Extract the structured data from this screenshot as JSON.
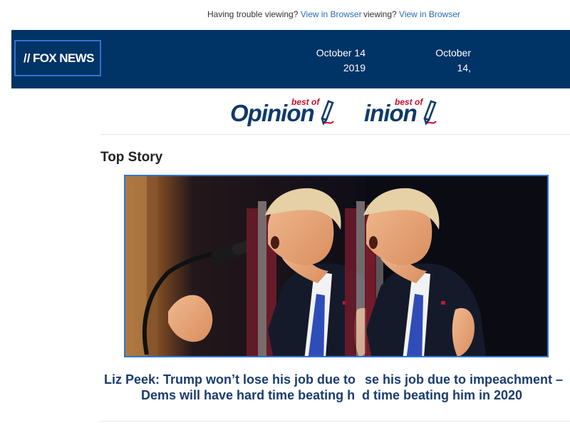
{
  "topbar": {
    "trouble_text": "Having trouble viewing?",
    "trouble_text_tail": "viewing?",
    "view_link": "View in Browser"
  },
  "header": {
    "logo_text": "FOX NEWS",
    "date_line1": "October 14,",
    "date_line2": "2019",
    "date_cut_line1": "October 14",
    "date_cut_line2": "2019"
  },
  "opinion": {
    "best_of": "best of",
    "word": "Opinion",
    "word_tail": "inion"
  },
  "section": {
    "title": "Top Story"
  },
  "story": {
    "image_alt": "Trump speaking at a microphone in front of an American flag",
    "headline_line1": "Liz Peek: Trump won’t lose his job due to",
    "headline_line1_tail": "se his job due to impeachment –",
    "headline_line2": "Dems will have hard time beating h",
    "headline_line2_tail": "d time beating him in 2020"
  },
  "colors": {
    "header_bg": "#003366",
    "accent_blue": "#2f74d0",
    "link_blue": "#2a6ab3",
    "headline": "#1b3d6d",
    "best_of_red": "#c8102e"
  }
}
